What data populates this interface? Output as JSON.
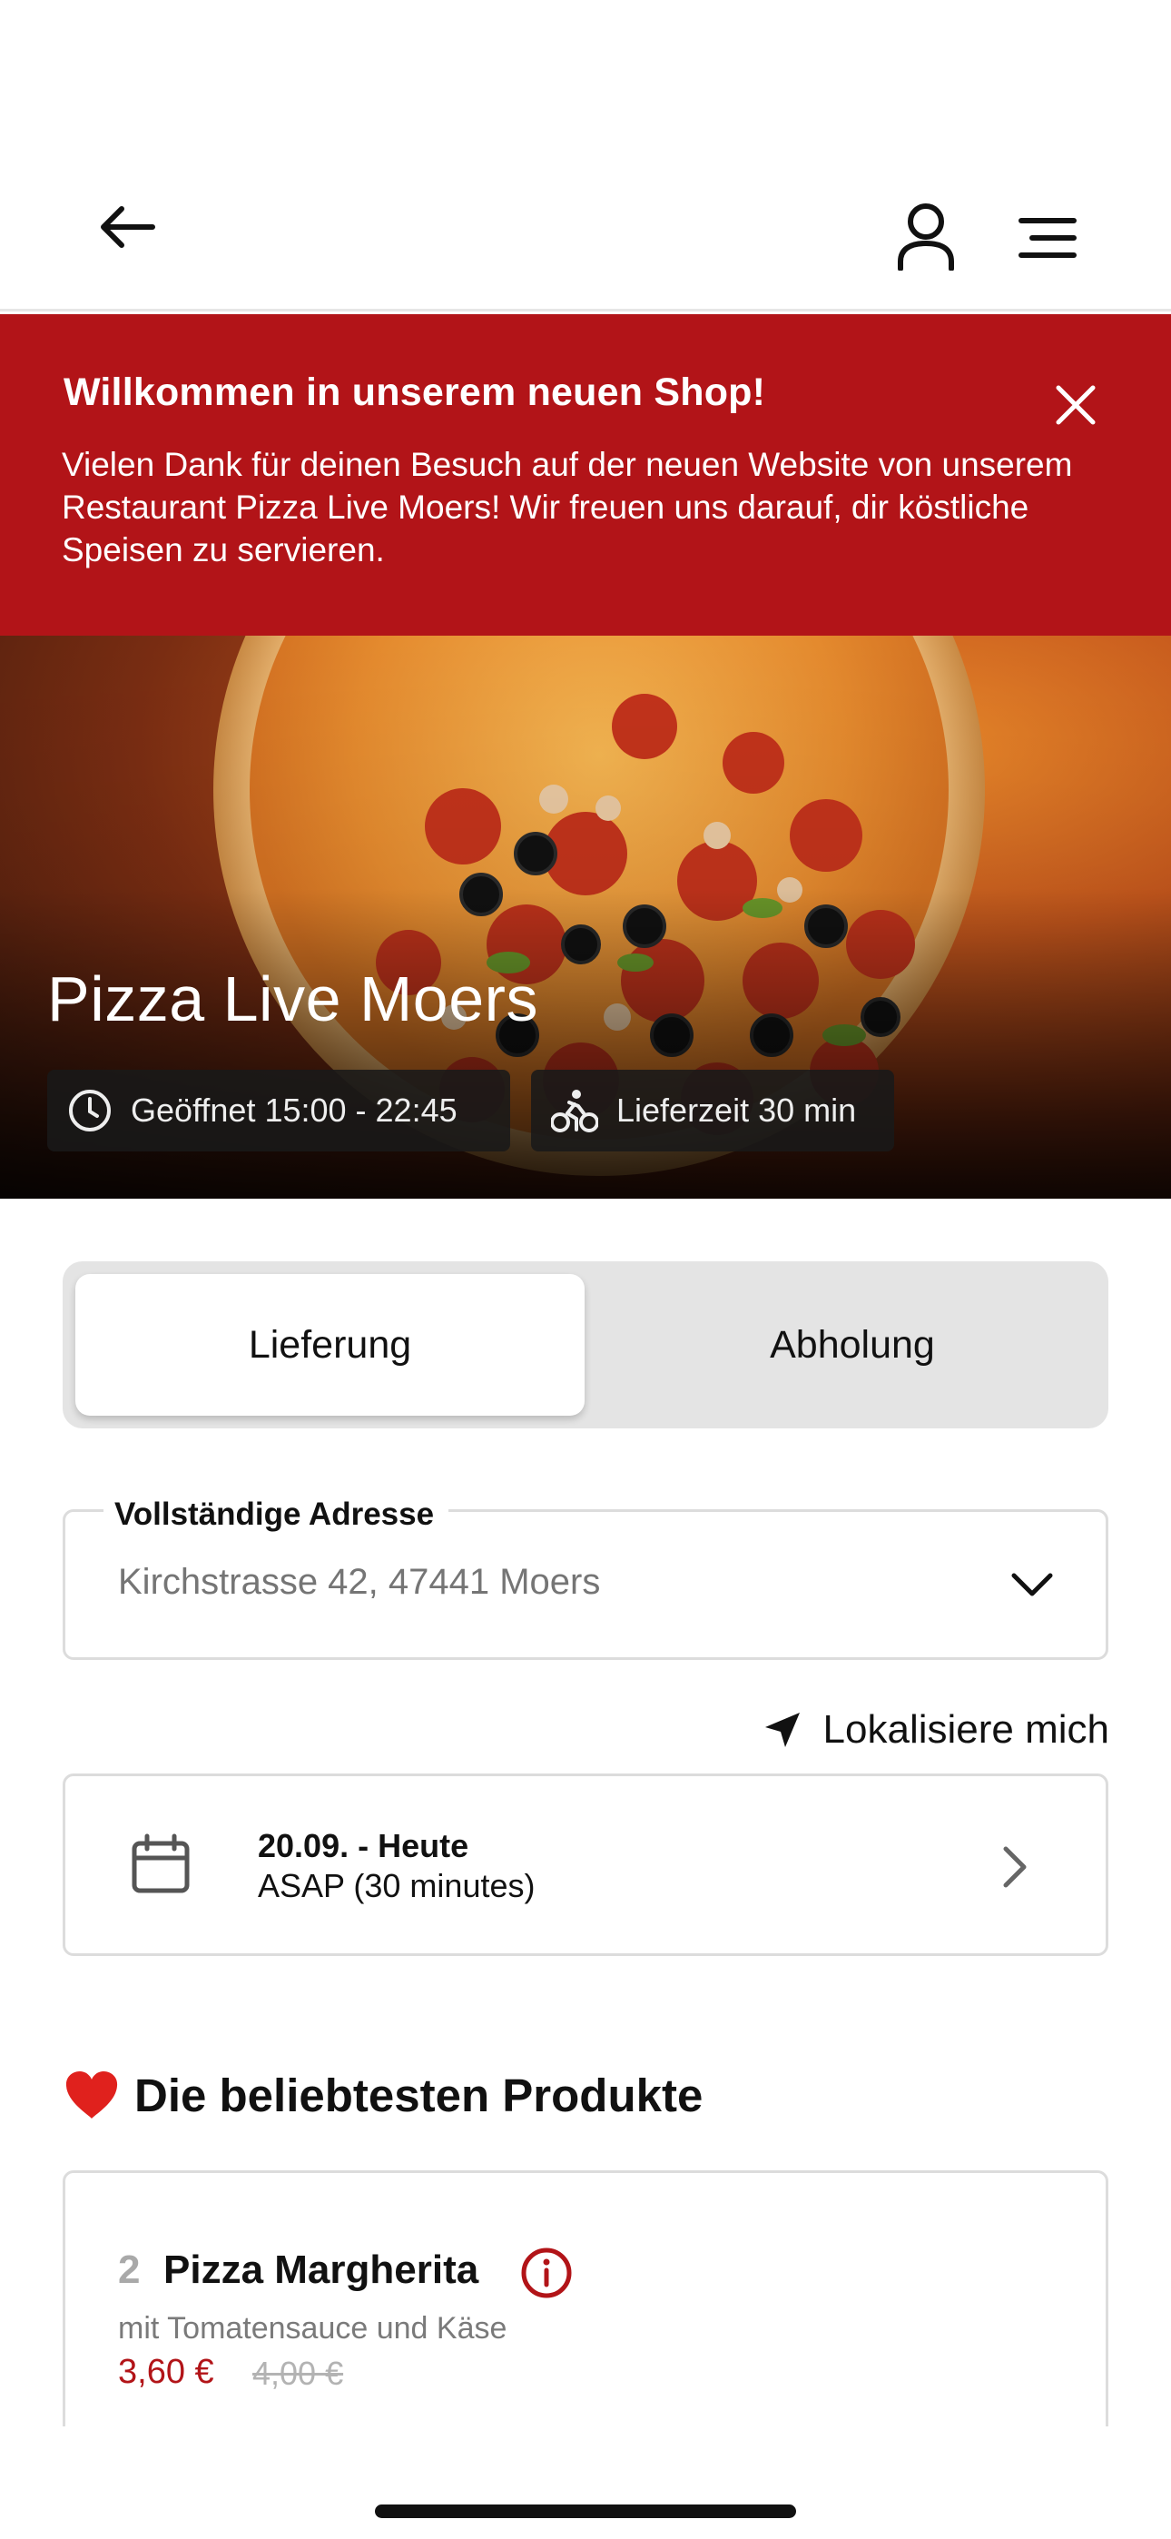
{
  "header": {
    "back_icon": "arrow-left-icon",
    "user_icon": "user-icon",
    "menu_icon": "hamburger-menu-icon"
  },
  "banner": {
    "title": "Willkommen in unserem neuen Shop!",
    "text": "Vielen Dank für deinen Besuch auf der neuen Website von unserem Restaurant Pizza Live Moers! Wir freuen uns darauf, dir köstliche Speisen zu servieren.",
    "close_icon": "close-icon",
    "background": "#b21418"
  },
  "hero": {
    "restaurant_name": "Pizza Live Moers",
    "opening_hours": "Geöffnet 15:00 - 22:45",
    "delivery_time": "Lieferzeit 30 min"
  },
  "mode_toggle": {
    "options": [
      "Lieferung",
      "Abholung"
    ],
    "selected": "Lieferung"
  },
  "address": {
    "label": "Vollständige Adresse",
    "placeholder": "Kirchstrasse 42, 47441 Moers"
  },
  "locate": {
    "label": "Lokalisiere mich",
    "icon": "location-arrow-icon"
  },
  "time_selection": {
    "date": "20.09. - Heute",
    "asap": "ASAP (30 minutes)",
    "icon": "calendar-icon"
  },
  "popular": {
    "title": "Die beliebtesten Produkte",
    "icon": "heart-icon",
    "products": [
      {
        "number": "2",
        "name": "Pizza Margherita",
        "description": "mit Tomatensauce und Käse",
        "price": "3,60 €",
        "old_price": "4,00 €"
      }
    ]
  },
  "colors": {
    "accent": "#b21418",
    "border": "#dcdcdc",
    "muted_text": "#7a7a7a"
  }
}
